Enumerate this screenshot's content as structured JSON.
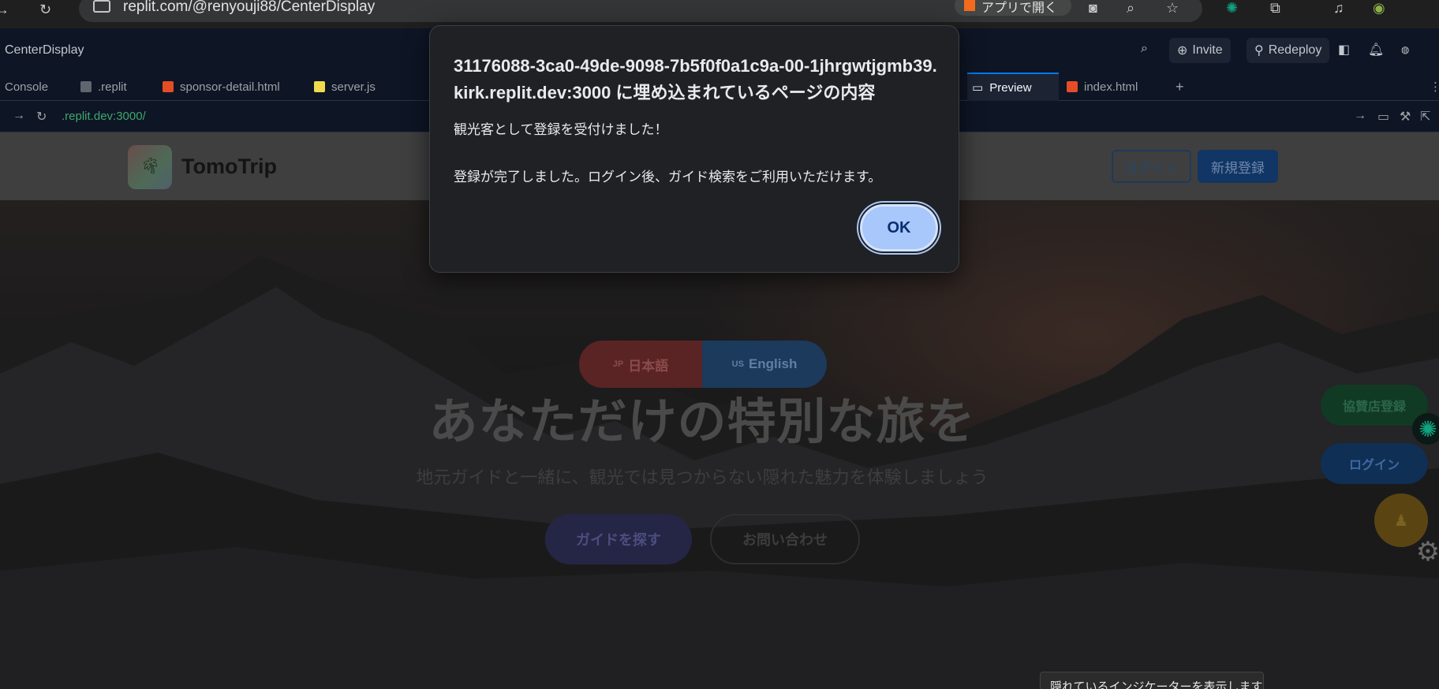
{
  "browser": {
    "url": "replit.com/@renyouji88/CenterDisplay",
    "open_app_label": "アプリで開く"
  },
  "replit": {
    "project_name": "CenterDisplay",
    "invite_label": "Invite",
    "redeploy_label": "Redeploy",
    "tabs": [
      {
        "label": "Console"
      },
      {
        "label": ".replit"
      },
      {
        "label": "sponsor-detail.html"
      },
      {
        "label": "server.js"
      },
      {
        "label": "Preview"
      },
      {
        "label": "index.html"
      }
    ],
    "preview_url": ".replit.dev:3000/"
  },
  "site": {
    "brand": "TomoTrip",
    "nav_login": "ログイン",
    "nav_signup": "新規登録",
    "lang_jp_flag": "JP",
    "lang_jp": "日本語",
    "lang_en_flag": "US",
    "lang_en": "English",
    "hero_title": "あなただけの特別な旅を",
    "hero_subtitle": "地元ガイドと一緒に、観光では見つからない隠れた魅力を体験しましょう",
    "btn_find_guide": "ガイドを探す",
    "btn_contact": "お問い合わせ",
    "float_sponsor": "協賛店登録",
    "float_login": "ログイン"
  },
  "dialog": {
    "title": "31176088-3ca0-49de-9098-7b5f0f0a1c9a-00-1jhrgwtjgmb39.kirk.replit.dev:3000 に埋め込まれているページの内容",
    "message": "観光客として登録を受付けました！\n\n登録が完了しました。ログイン後、ガイド検索をご利用いただけます。",
    "ok_label": "OK"
  },
  "tooltip": "隠れているインジケーターを表示します",
  "colors": {
    "accent": "#0079f2",
    "dialog_ok": "#a8c7fa",
    "preview_url": "#3ea86d"
  }
}
